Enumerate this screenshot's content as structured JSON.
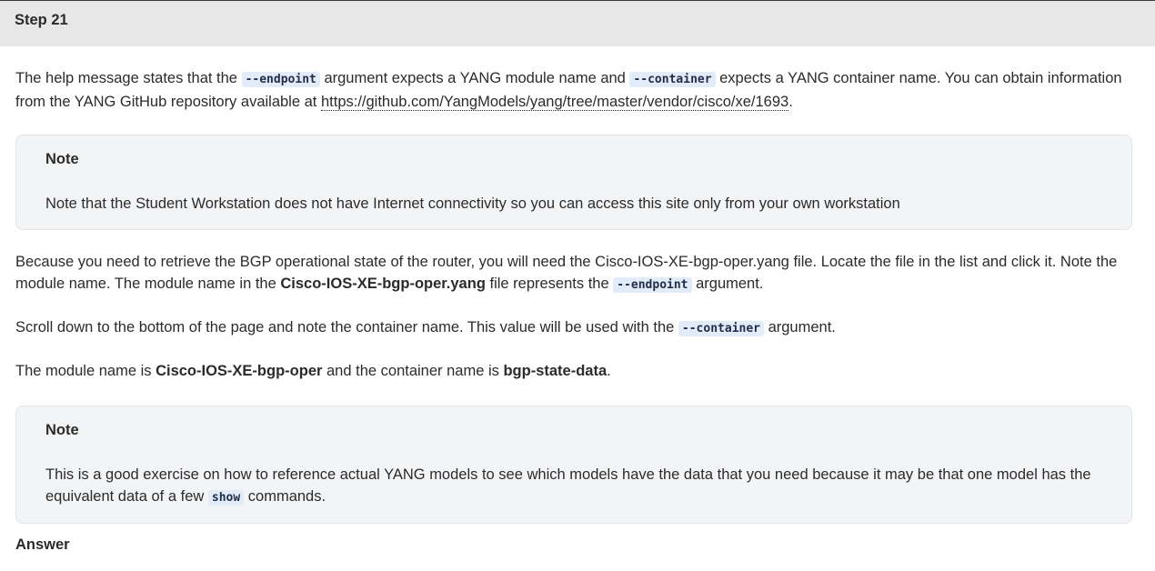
{
  "step": {
    "title": "Step 21"
  },
  "p1": {
    "t1": "The help message states that the ",
    "code1": "--endpoint",
    "t2": " argument expects a YANG module name and ",
    "code2": "--container",
    "t3": " expects a YANG container name. You can obtain information from the YANG GitHub repository available at ",
    "link": "https://github.com/YangModels/yang/tree/master/vendor/cisco/xe/1693",
    "t4": "."
  },
  "note1": {
    "title": "Note",
    "body": "Note that the Student Workstation does not have Internet connectivity so you can access this site only from your own workstation"
  },
  "p2": {
    "t1": "Because you need to retrieve the BGP operational state of the router, you will need the Cisco-IOS-XE-bgp-oper.yang file. Locate the file in the list and click it. Note the module name. The module name in the ",
    "bold1": "Cisco-IOS-XE-bgp-oper.yang",
    "t2": " file represents the ",
    "code1": "--endpoint",
    "t3": " argument."
  },
  "p3": {
    "t1": "Scroll down to the bottom of the page and note the container name. This value will be used with the ",
    "code1": "--container",
    "t2": " argument."
  },
  "p4": {
    "t1": "The module name is ",
    "bold1": "Cisco-IOS-XE-bgp-oper",
    "t2": " and the container name is ",
    "bold2": "bgp-state-data",
    "t3": "."
  },
  "note2": {
    "title": "Note",
    "t1": "This is a good exercise on how to reference actual YANG models to see which models have the data that you need because it may be that one model has the equivalent data of a few ",
    "code1": "show",
    "t2": " commands."
  },
  "answer": {
    "label": "Answer"
  }
}
